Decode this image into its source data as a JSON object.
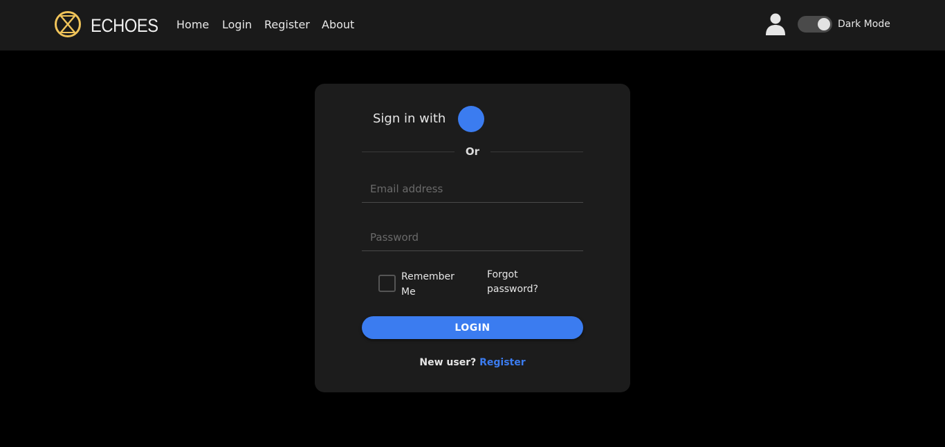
{
  "colors": {
    "page_bg": "#000000",
    "navbar_bg": "#1a1a1a",
    "card_bg": "#1c1c1c",
    "accent": "#3b7cf0",
    "logo_gold": "#f0c45a"
  },
  "navbar": {
    "logo_icon": "x-circle-logo-icon",
    "brand": "ECHOES",
    "links": [
      {
        "label": "Home"
      },
      {
        "label": "Login"
      },
      {
        "label": "Register"
      },
      {
        "label": "About"
      }
    ],
    "user_icon": "user-icon",
    "dark_mode_label": "Dark Mode",
    "dark_mode_on": true
  },
  "login_card": {
    "sign_in_with": "Sign in with",
    "or_text": "Or",
    "email": {
      "placeholder": "Email address",
      "value": ""
    },
    "password": {
      "placeholder": "Password",
      "value": ""
    },
    "remember_me": "Remember Me",
    "remember_checked": false,
    "forgot_password": "Forgot password?",
    "login_button": "LOGIN",
    "new_user_text": "New user?",
    "register_link": "Register"
  }
}
